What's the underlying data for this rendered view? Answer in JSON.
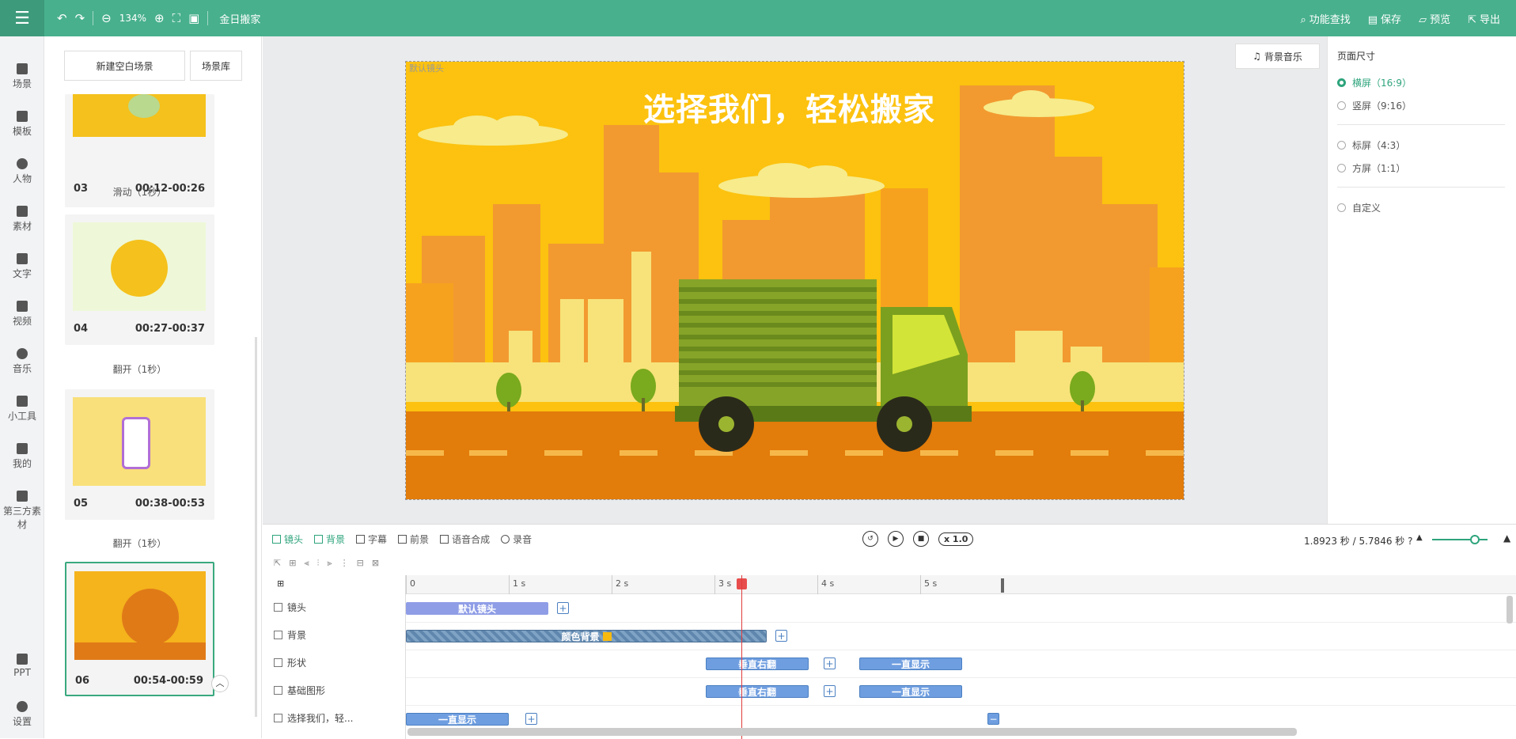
{
  "topbar": {
    "zoom": "134%",
    "project_name": "金日搬家",
    "find": "功能查找",
    "save": "保存",
    "preview": "预览",
    "export": "导出"
  },
  "nav": [
    "场景",
    "模板",
    "人物",
    "素材",
    "文字",
    "视频",
    "音乐",
    "小工具",
    "我的",
    "第三方素材",
    "PPT",
    "设置"
  ],
  "scenes": {
    "new_blank": "新建空白场景",
    "library": "场景库",
    "items": [
      {
        "num": "03",
        "time": "00:12-00:26"
      },
      {
        "num": "04",
        "time": "00:27-00:37"
      },
      {
        "num": "05",
        "time": "00:38-00:53"
      },
      {
        "num": "06",
        "time": "00:54-00:59"
      }
    ],
    "transitions": [
      "滑动（1秒）",
      "翻开（1秒）",
      "翻开（1秒）"
    ]
  },
  "stage": {
    "camera_label": "默认镜头",
    "headline": "选择我们，轻松搬家"
  },
  "music_button": "背景音乐",
  "page_size": {
    "title": "页面尺寸",
    "options": [
      "横屏（16:9）",
      "竖屏（9:16）",
      "标屏（4:3）",
      "方屏（1:1）",
      "自定义"
    ],
    "selected": "横屏（16:9）"
  },
  "timeline": {
    "tabs": [
      "镜头",
      "背景",
      "字幕",
      "前景",
      "语音合成",
      "录音"
    ],
    "speed": "x 1.0",
    "time_info": "1.8923 秒 / 5.7846 秒",
    "ticks": [
      "0",
      "1 s",
      "2 s",
      "3 s",
      "4 s",
      "5 s"
    ],
    "tracks": [
      "镜头",
      "背景",
      "形状",
      "基础图形",
      "选择我们，轻..."
    ],
    "clips": {
      "camera": "默认镜头",
      "bg": "颜色背景",
      "shape_anim": "垂直右翻",
      "shape_show": "一直显示",
      "basic_anim": "垂直右翻",
      "basic_show": "一直显示",
      "text_show": "一直显示"
    }
  }
}
